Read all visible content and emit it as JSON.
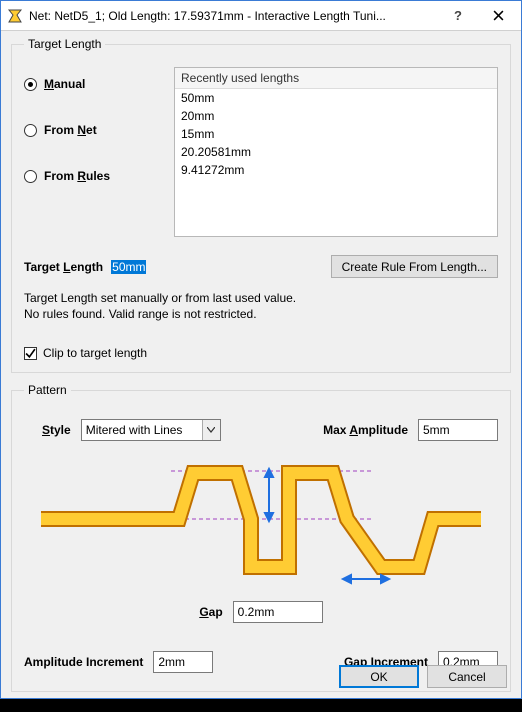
{
  "title": "Net: NetD5_1;  Old Length: 17.59371mm -  Interactive Length Tuni...",
  "target_group": {
    "legend": "Target Length",
    "radios": {
      "manual": "Manual",
      "from_net": "From Net",
      "from_rules": "From Rules"
    },
    "recent_header": "Recently used lengths",
    "recent": [
      "50mm",
      "20mm",
      "15mm",
      "20.20581mm",
      "9.41272mm"
    ],
    "target_label_pre": "Target ",
    "target_label_ul": "L",
    "target_label_post": "ength",
    "target_value": "50mm",
    "create_rule_btn": "Create Rule From Length...",
    "msg_line1": "Target Length set manually or from last used value.",
    "msg_line2": " No rules found. Valid range is not restricted.",
    "clip_label": "Clip to target length"
  },
  "pattern_group": {
    "legend": "Pattern",
    "style_label_ul": "S",
    "style_label_post": "tyle",
    "style_value": "Mitered with Lines",
    "maxamp_label_pre": "Max ",
    "maxamp_label_ul": "A",
    "maxamp_label_post": "mplitude",
    "maxamp_value": "5mm",
    "gap_label_ul": "G",
    "gap_label_post": "ap",
    "gap_value": "0.2mm",
    "amp_inc_label": "Amplitude Increment",
    "amp_inc_value": "2mm",
    "gap_inc_label": "Gap Increment",
    "gap_inc_value": "0.2mm"
  },
  "footer": {
    "ok": "OK",
    "cancel": "Cancel"
  }
}
